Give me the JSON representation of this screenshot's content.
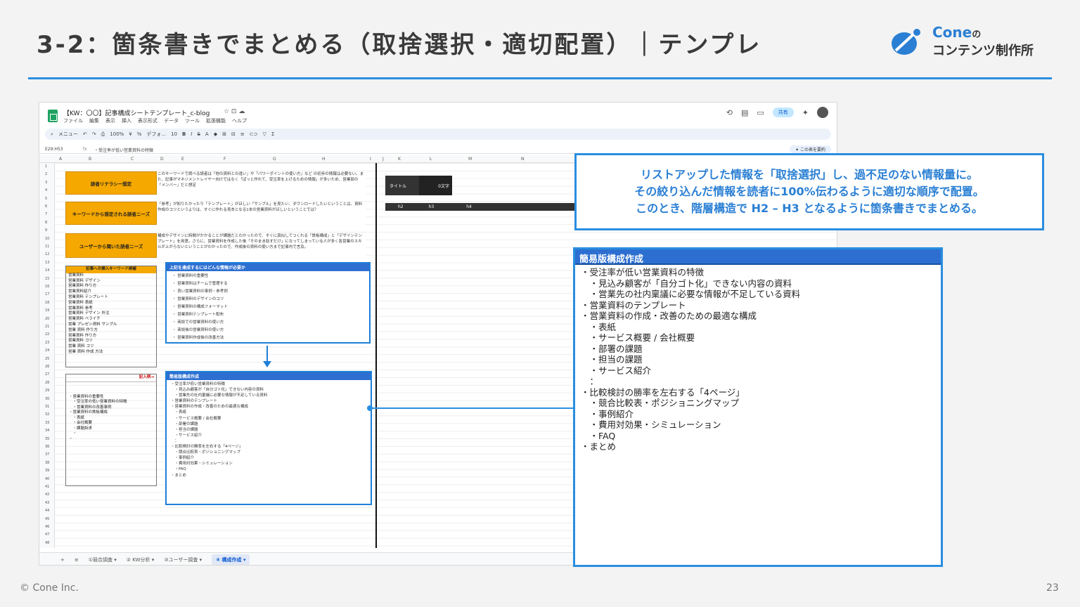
{
  "slide": {
    "title": "3-2：箇条書きでまとめる（取捨選択・適切配置）｜テンプレ",
    "logo_line1": "Cone",
    "logo_line1_suffix": "の",
    "logo_line2": "コンテンツ制作所",
    "copyright": "© Cone Inc.",
    "page_number": "23",
    "accent_color": "#2a8ee0"
  },
  "sheet": {
    "doc_title": "【KW：〇〇】記事構成シートテンプレート_c-blog",
    "doc_icons": "☆ ⊡ ☁",
    "menu": [
      "ファイル",
      "編集",
      "表示",
      "挿入",
      "表示形式",
      "データ",
      "ツール",
      "拡張機能",
      "ヘルプ"
    ],
    "share_label": "共有",
    "toolbar_search": "メニュー",
    "toolbar_zoom": "100%",
    "toolbar_font": "デフォ...",
    "toolbar_size": "10",
    "cell_ref": "E29:H53",
    "fx": "fx",
    "formula_text": "・受注率が低い営業資料の特徴",
    "summarize_btn": "✦ この表を要約",
    "columns": [
      "A",
      "B",
      "C",
      "D",
      "E",
      "F",
      "G",
      "H",
      "I",
      "J",
      "K",
      "L",
      "M",
      "N"
    ],
    "rows": [
      "1",
      "2",
      "3",
      "4",
      "5",
      "6",
      "7",
      "8",
      "9",
      "10",
      "11",
      "12",
      "13",
      "14",
      "15",
      "16",
      "17",
      "18",
      "19",
      "20",
      "21",
      "22",
      "23",
      "24",
      "25",
      "26",
      "27",
      "28",
      "29",
      "30",
      "31",
      "32",
      "33",
      "34",
      "35",
      "36",
      "37",
      "38",
      "39",
      "40",
      "41",
      "42",
      "43",
      "44",
      "45",
      "46",
      "47",
      "48"
    ],
    "label_literacy": "読者リテラシー想定",
    "desc_literacy": "このキーワードで調べる読者は「他の資料との違い」や「パワーポイントの使い方」など の初歩の情報は必要ない。また、記事がマネジメントレイヤー向けではなく「ぱっと作れて、受注率を上げるための情報」が多いため、営業部の「メンバー」だと想定",
    "label_needs": "キーワードから想定される読者ニーズ",
    "desc_needs": "「参考」が知りたかったり「テンプレート」がほしい「サンプル」を見たい、ダウンロードしたいということは、資料作成のコツというよりは、すぐに作れる見本となる1本の営業資料がほしいということでは？",
    "label_heard": "ユーザーから聞いた読者ニーズ",
    "desc_heard": "構成やデザインに時間がかかることが課題だとわかったので、すぐに真似してつくれる「鉄板構成」と「デザインテンプレート」を用意。さらに、営業資料を作成した後「そのまま話すだけ」になってしまっている人が多く各営業のスキルが上がらないということがわかったので、作成後の資料の使い方まで記事内で言及。",
    "kw_header": "記事への挿入キーワード候補",
    "keywords": [
      "営業資料",
      "営業資料 デザイン",
      "営業資料 作り方",
      "営業資料紹介",
      "営業資料 テンプレート",
      "営業資料 表紙",
      "営業資料 参考",
      "営業資料 デザイン 外注",
      "営業資料 ベライチ",
      "営業 プレゼン資料 サンプル",
      "営業 資料 作り方",
      "営業資料 作り方",
      "営業資料 コツ",
      "営業 資料 コツ",
      "営業 資料 作成 方法"
    ],
    "example_header": "記入例→",
    "example_list": "・営業資料の重要性\n　・受注率の低い営業資料の特徴\n　・営業資料の改善事例\n・営業資料の鉄板構成\n　・表紙\n　・会社概要\n　・課題訴求\n　・\n・",
    "needs_box_header": "上記を達成するにはどんな情報が必要か",
    "needs_items": [
      "営業資料の重要性",
      "営業資料はチームで管理する",
      "良い営業資料の事例・参考例",
      "営業資料のデザインのコツ",
      "営業資料の構成フォーマット",
      "営業資料テンプレート配布",
      "商談での営業資料の使い方",
      "商談後の営業資料の使い方",
      "営業資料作成後の改善方法"
    ],
    "small_outline_header": "簡易版構成作成",
    "small_outline": "・受注率が低い営業資料の特徴\n　・見込み顧客が「自分ゴト化」できない内容の資料\n　・営業先の社内稟議に必要な情報が不足している資料\n・営業資料のテンプレート\n・営業資料の作成・改善のための最適な構成\n　・表紙\n　・サービス概要 / 会社概要\n　・部署の課題\n　・担当の課題\n　・サービス紹介\n　：\n・比較検討の勝率を左右する「4ページ」\n　・競合比較表・ポジショニングマップ\n　・事例紹介\n　・費用対効果・シミュレーション\n　・FAQ\n・まとめ",
    "title_label": "タイトル",
    "zero_chars": "0文字",
    "h2": "h2",
    "h3": "h3",
    "h4": "h4",
    "tabs": [
      "①競合調査 ▾",
      "② KW分析 ▾",
      "③ユーザー調査 ▾",
      "④ 構成作成 ▾"
    ]
  },
  "callout": {
    "line1": "リストアップした情報を「取捨選択」し、過不足のない情報量に。",
    "line2": "その絞り込んだ情報を読者に100%伝わるように適切な順序で配置。",
    "line3": "このとき、階層構造で H2 – H3 となるように箇条書きでまとめる。"
  },
  "outline": {
    "header": "簡易版構成作成",
    "text": "・受注率が低い営業資料の特徴\n　・見込み顧客が「自分ゴト化」できない内容の資料\n　・営業先の社内稟議に必要な情報が不足している資料\n・営業資料のテンプレート\n・営業資料の作成・改善のための最適な構成\n　・表紙\n　・サービス概要 / 会社概要\n　・部署の課題\n　・担当の課題\n　・サービス紹介\n　：\n・比較検討の勝率を左右する「4ページ」\n　・競合比較表・ポジショニングマップ\n　・事例紹介\n　・費用対効果・シミュレーション\n　・FAQ\n・まとめ"
  }
}
